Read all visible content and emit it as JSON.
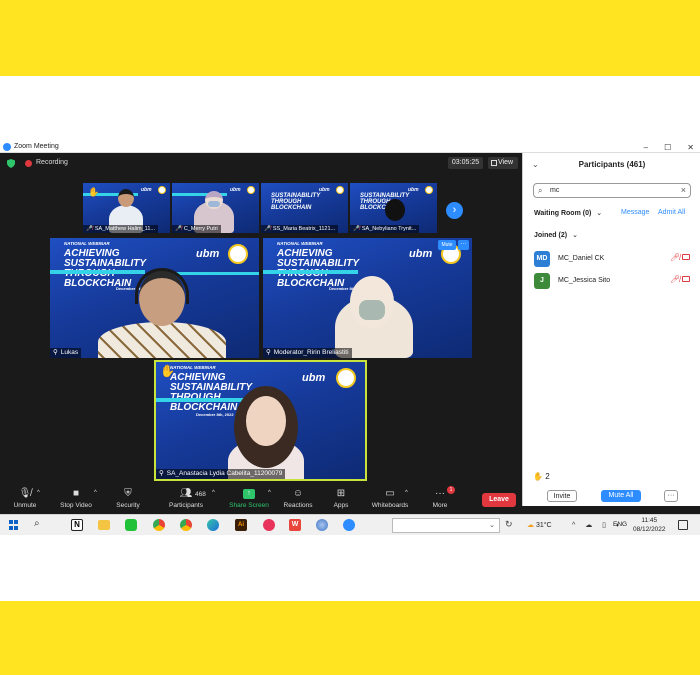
{
  "window": {
    "title": "Zoom Meeting",
    "controls": [
      "–",
      "☐",
      "✕"
    ]
  },
  "status": {
    "recording_label": "Recording",
    "timer": "03:05:25",
    "view_label": "View"
  },
  "colors": {
    "brand_blue": "#2D8CFF",
    "leave_red": "#E0383E",
    "banner_yellow": "#FFE521",
    "slide_cyan": "#35D3E8",
    "share_green": "#2EC56B"
  },
  "slide": {
    "headline_small": "NATIONAL WEBINAR",
    "line1": "ACHIEVING",
    "line2": "SUSTAINABILITY",
    "line3": "THROUGH",
    "line4": "BLOCKCHAIN",
    "date": "December 8th, 2022",
    "logo": "ubm"
  },
  "thumbnails": [
    {
      "name": "SA_Matthew Halim_11...",
      "mic_off": true
    },
    {
      "name": "C_Merry Putri",
      "mic_off": true
    },
    {
      "name": "SS_Maria Beatrix_1121...",
      "mic_off": true
    },
    {
      "name": "SA_Nebyliano Trynit...",
      "mic_off": true
    }
  ],
  "main_tiles": [
    {
      "name": "Lukas"
    },
    {
      "name": "Moderator_Ririn Breliastiti",
      "mute_label": "Mute"
    },
    {
      "name": "SA_Anastacia Lydia Cabelita_11200079"
    }
  ],
  "toolbar": {
    "unmute": "Unmute",
    "stop_video": "Stop Video",
    "security": "Security",
    "participants": "Participants",
    "participants_count": "468",
    "share_screen": "Share Screen",
    "reactions": "Reactions",
    "apps": "Apps",
    "whiteboards": "Whiteboards",
    "more": "More",
    "more_badge": "1",
    "leave": "Leave"
  },
  "panel": {
    "title": "Participants (461)",
    "search_value": "mc",
    "waiting_room": "Waiting Room (0)",
    "message": "Message",
    "admit_all": "Admit All",
    "joined": "Joined (2)",
    "participants": [
      {
        "initials": "MD",
        "name": "MC_Daniel CK",
        "color": "#2D7FD6"
      },
      {
        "initials": "J",
        "name": "MC_Jessica Sito",
        "color": "#3C8A3A"
      }
    ],
    "raised_hands": "2",
    "invite": "Invite",
    "mute_all": "Mute All",
    "more": "···"
  },
  "taskbar": {
    "weather": "31°C",
    "lang": "ENG",
    "time": "11:45",
    "date": "08/12/2022"
  }
}
